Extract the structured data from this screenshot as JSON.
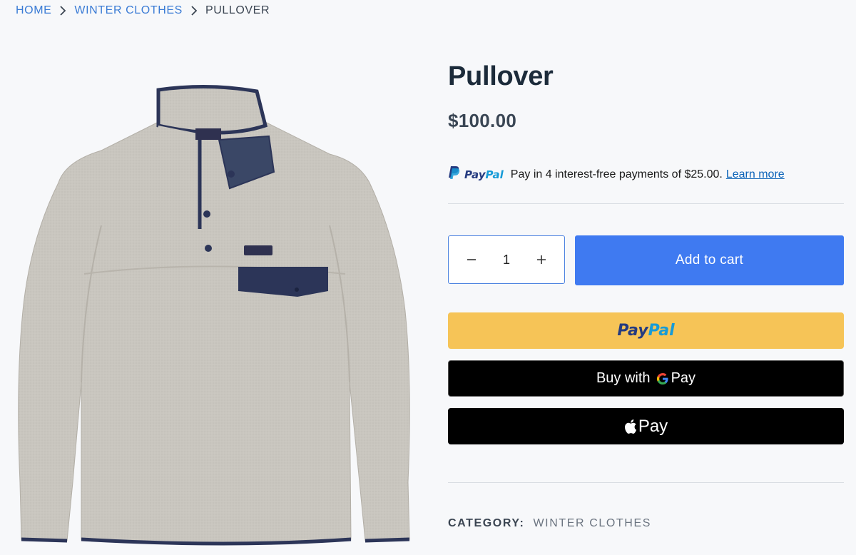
{
  "breadcrumb": {
    "home": "HOME",
    "category": "WINTER CLOTHES",
    "current": "PULLOVER"
  },
  "product": {
    "title": "Pullover",
    "price": "$100.00",
    "image_alt": "Pullover"
  },
  "paypal_message": {
    "logo_pay": "Pay",
    "logo_pal": "Pal",
    "text": "Pay in 4 interest-free payments of $25.00.",
    "link": "Learn more"
  },
  "cart": {
    "minus": "−",
    "quantity": "1",
    "plus": "+",
    "add_label": "Add to cart"
  },
  "payment_buttons": {
    "paypal_pay": "Pay",
    "paypal_pal": "Pal",
    "gpay_prefix": "Buy with",
    "gpay_suffix": "Pay",
    "applepay": "Pay"
  },
  "category": {
    "label": "CATEGORY:",
    "value": "WINTER CLOTHES"
  },
  "colors": {
    "accent": "#3f7af1",
    "paypal_yellow": "#f6c457",
    "link": "#3a7bd5"
  }
}
